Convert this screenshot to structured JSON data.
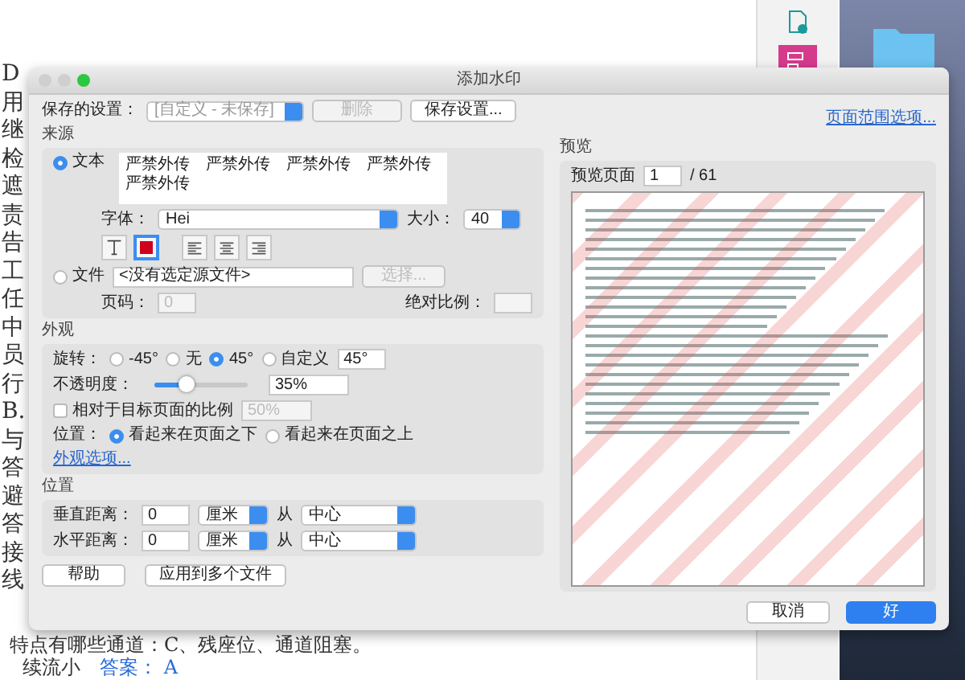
{
  "document": {
    "lines": [
      "D",
      "用",
      "继",
      "检",
      "遮",
      "责",
      "告",
      "工",
      "任",
      "中",
      "员",
      "行",
      "B.",
      "与",
      "答",
      "避",
      "答",
      "接",
      "线"
    ],
    "bottom_line": "特点有哪些通道：C、残座位、通道阻塞。",
    "last_line": {
      "text": "续流小",
      "answer": "答案： A"
    }
  },
  "dialog": {
    "title": "添加水印",
    "saved_settings": {
      "label": "保存的设置：",
      "value": "[自定义 - 未保存]"
    },
    "delete_button": {
      "label": "删除",
      "disabled": true
    },
    "save_button": "保存设置...",
    "page_range_link": "页面范围选项...",
    "source": {
      "heading": "来源",
      "options": [
        {
          "label": "文本",
          "selected": true
        },
        {
          "label": "文件",
          "selected": false
        }
      ],
      "text_lines": [
        "严禁外传　严禁外传　严禁外传　严禁外传",
        "严禁外传"
      ],
      "font_label": "字体：",
      "font_value": "Hei",
      "size_label": "大小：",
      "size_value": "40",
      "tools": [
        {
          "kind": "text",
          "selected": false
        },
        {
          "kind": "color",
          "selected": true,
          "color": "#d0021b"
        },
        {
          "kind": "left",
          "selected": false
        },
        {
          "kind": "center",
          "selected": false
        },
        {
          "kind": "right",
          "selected": false
        }
      ],
      "file_value": "<没有选定源文件>",
      "choose_button": {
        "label": "选择...",
        "disabled": true
      },
      "page_label": "页码：",
      "page_value": "0",
      "fields_disabled": true,
      "scale_label": "绝对比例："
    },
    "appearance": {
      "heading": "外观",
      "rotation_label": "旋转：",
      "rotations": [
        {
          "label": "-45°",
          "selected": false
        },
        {
          "label": "无",
          "selected": false
        },
        {
          "label": "45°",
          "selected": true
        },
        {
          "label": "自定义",
          "selected": false
        }
      ],
      "custom_value": "45°",
      "opacity_label": "不透明度：",
      "level": 0.35,
      "opacity_value": "35%",
      "relative": {
        "label": "相对于目标页面的比例",
        "checked": false,
        "value": "50%",
        "disabled": true
      },
      "position_label": "位置：",
      "positions": [
        {
          "label": "看起来在页面之下",
          "selected": true
        },
        {
          "label": "看起来在页面之上",
          "selected": false
        }
      ],
      "options_link": "外观选项..."
    },
    "position": {
      "heading": "位置",
      "rows": [
        {
          "label": "垂直距离：",
          "value": "0",
          "unit": "厘米",
          "from": "从",
          "anchor": "中心"
        },
        {
          "label": "水平距离：",
          "value": "0",
          "unit": "厘米",
          "from": "从",
          "anchor": "中心"
        }
      ]
    },
    "help_button": "帮助",
    "apply_button": "应用到多个文件",
    "preview": {
      "heading": "预览",
      "page_label": "预览页面",
      "page_value": "1",
      "total": "/ 61"
    },
    "cancel_button": "取消",
    "ok_button": "好"
  }
}
